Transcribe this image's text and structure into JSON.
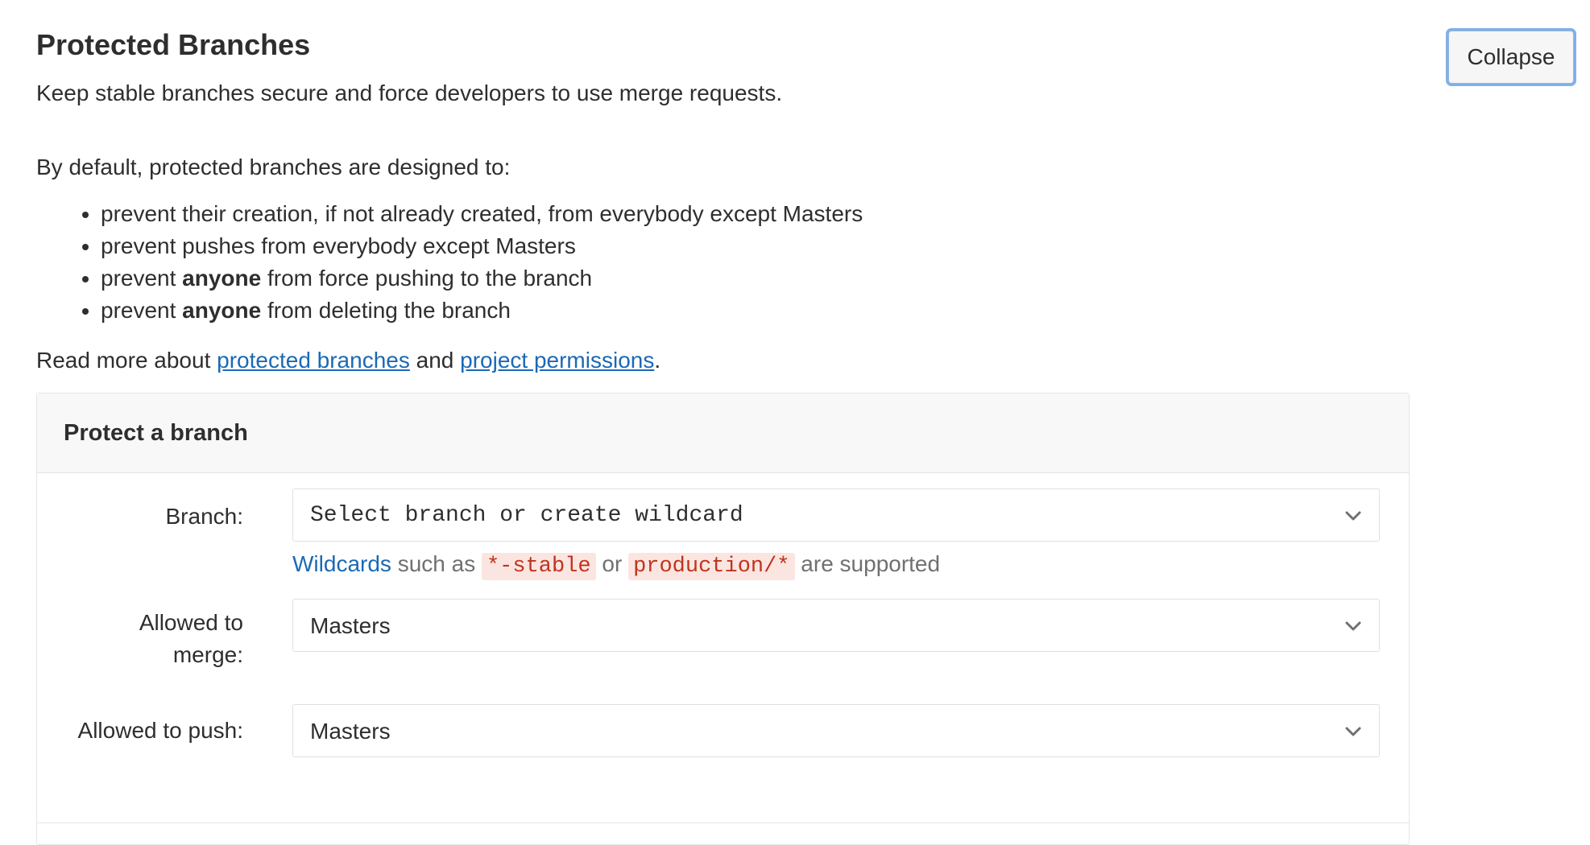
{
  "header": {
    "title": "Protected Branches",
    "subtitle": "Keep stable branches secure and force developers to use merge requests.",
    "collapse_label": "Collapse"
  },
  "intro": "By default, protected branches are designed to:",
  "rules": [
    {
      "before": "prevent their creation, if not already created, from everybody except Masters",
      "bold": "",
      "after": ""
    },
    {
      "before": "prevent pushes from everybody except Masters",
      "bold": "",
      "after": ""
    },
    {
      "before": "prevent ",
      "bold": "anyone",
      "after": " from force pushing to the branch"
    },
    {
      "before": "prevent ",
      "bold": "anyone",
      "after": " from deleting the branch"
    }
  ],
  "readmore": {
    "prefix": "Read more about ",
    "link1": "protected branches",
    "middle": " and ",
    "link2": "project permissions",
    "suffix": "."
  },
  "panel": {
    "title": "Protect a branch",
    "branch": {
      "label": "Branch:",
      "value": "Select branch or create wildcard",
      "hint_link": "Wildcards",
      "hint_text1": " such as ",
      "hint_code1": "*-stable",
      "hint_text2": " or ",
      "hint_code2": "production/*",
      "hint_text3": " are supported"
    },
    "merge": {
      "label_line1": "Allowed to",
      "label_line2": "merge:",
      "value": "Masters"
    },
    "push": {
      "label": "Allowed to push:",
      "value": "Masters"
    }
  },
  "colors": {
    "link": "#1b69b6",
    "code_text": "#c0341d",
    "code_bg": "#fbe5e1",
    "focus_ring": "#7fb0ea"
  },
  "icons": {
    "dropdown": "chevron-down-icon"
  }
}
